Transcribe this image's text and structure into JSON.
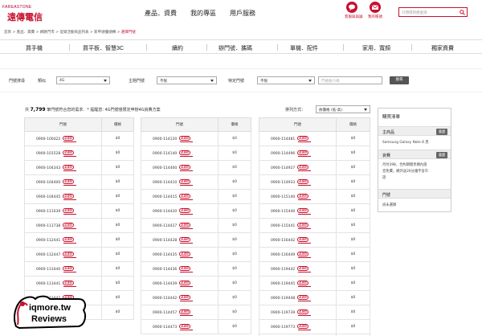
{
  "brand": {
    "en": "FAREASTONE",
    "zh": "遠傳電信"
  },
  "topnav": [
    "產品．資費",
    "我的專區",
    "用戶服務"
  ],
  "top_icons": [
    {
      "label": "客服與與論",
      "icon": "chat-icon"
    },
    {
      "label": "我的帳號",
      "icon": "account-icon"
    }
  ],
  "search": {
    "placeholder": "只問得到想查詢"
  },
  "breadcrumb": {
    "items": [
      "首頁",
      "產品．資費",
      "網路門市",
      "促銷活動商品列表",
      "新申請攜號轉",
      "選擇門號"
    ],
    "sep": ">"
  },
  "categories": [
    "買手機",
    "買平板．智慧3C",
    "續約",
    "辦門號．攜碼",
    "單機．配件",
    "家用．寬頻",
    "獨家資費"
  ],
  "filter": {
    "label_pick": "門號搜尋",
    "label_type": "類似",
    "type_value": "4G",
    "label_theme": "主題門號",
    "theme_value": "不限",
    "label_special": "特定門號",
    "special_value": "不限",
    "tail_placeholder": "門號後六碼",
    "search_button": "搜尋"
  },
  "summary": {
    "prefix": "共",
    "count": "7,799",
    "suffix": "筆門號符合您的需求．* 提醒您: 4G門號僅限定申辦4G資費方案"
  },
  "sort": {
    "label": "排列方式：",
    "value": "依價格 (低-高)"
  },
  "table_headers": {
    "number": "門號",
    "price": "價格"
  },
  "badge_text": "4.5G",
  "tables": [
    {
      "rows": [
        {
          "number": "0900-100422",
          "price": "$0"
        },
        {
          "number": "0900-101528",
          "price": "$0"
        },
        {
          "number": "0900-104343",
          "price": "$0"
        },
        {
          "number": "0900-104400",
          "price": "$0"
        },
        {
          "number": "0900-104445",
          "price": "$0"
        },
        {
          "number": "0900-111039",
          "price": "$0"
        },
        {
          "number": "0900-111738",
          "price": "$0"
        },
        {
          "number": "0900-112441",
          "price": "$0"
        },
        {
          "number": "0900-112447",
          "price": "$0"
        },
        {
          "number": "0900-113440",
          "price": "$0"
        },
        {
          "number": "0900-113441",
          "price": "$0"
        },
        {
          "number": "0900-113442",
          "price": "$0"
        },
        {
          "number": "0900-113447",
          "price": "$0"
        }
      ]
    },
    {
      "rows": [
        {
          "number": "0900-114120",
          "price": "$0"
        },
        {
          "number": "0900-114140",
          "price": "$0"
        },
        {
          "number": "0900-114400",
          "price": "$0"
        },
        {
          "number": "0900-114410",
          "price": "$0"
        },
        {
          "number": "0900-114415",
          "price": "$0"
        },
        {
          "number": "0900-114420",
          "price": "$0"
        },
        {
          "number": "0900-114427",
          "price": "$0"
        },
        {
          "number": "0900-114428",
          "price": "$0"
        },
        {
          "number": "0900-114435",
          "price": "$0"
        },
        {
          "number": "0900-114436",
          "price": "$0"
        },
        {
          "number": "0900-114439",
          "price": "$0"
        },
        {
          "number": "0900-114442",
          "price": "$0"
        },
        {
          "number": "0900-114457",
          "price": "$0"
        },
        {
          "number": "0900-114473",
          "price": "$0"
        }
      ]
    },
    {
      "rows": [
        {
          "number": "0900-114481",
          "price": "$0"
        },
        {
          "number": "0900-114496",
          "price": "$0"
        },
        {
          "number": "0900-114927",
          "price": "$0"
        },
        {
          "number": "0900-114933",
          "price": "$0"
        },
        {
          "number": "0900-115140",
          "price": "$0"
        },
        {
          "number": "0900-115440",
          "price": "$0"
        },
        {
          "number": "0900-115441",
          "price": "$0"
        },
        {
          "number": "0900-116442",
          "price": "$0"
        },
        {
          "number": "0900-116449",
          "price": "$0"
        },
        {
          "number": "0900-119442",
          "price": "$0"
        },
        {
          "number": "0900-119445",
          "price": "$0"
        },
        {
          "number": "0900-119448",
          "price": "$0"
        },
        {
          "number": "0900-119739",
          "price": "$0"
        },
        {
          "number": "0900-119773",
          "price": "$0"
        },
        {
          "number": "0900-119788",
          "price": "$0"
        }
      ]
    }
  ],
  "cart": {
    "title": "購買清單",
    "product_label": "主商品",
    "product_edit": "重選",
    "product_value": "Samsung Galaxy Note 8 黑",
    "plan_label": "資費",
    "plan_edit": "重選",
    "plan_lines": [
      "月付398，合約期間享網內語",
      "音免費，網外送20分鐘不含市",
      "話"
    ],
    "number_label": "門號",
    "number_value": "尚未選擇"
  },
  "watermark": {
    "line1": "iqmore.tw",
    "line2": "Reviews"
  },
  "colors": {
    "brand_red": "#c8102e",
    "header_gray": "#f3f3f3",
    "button_gray": "#555555"
  }
}
